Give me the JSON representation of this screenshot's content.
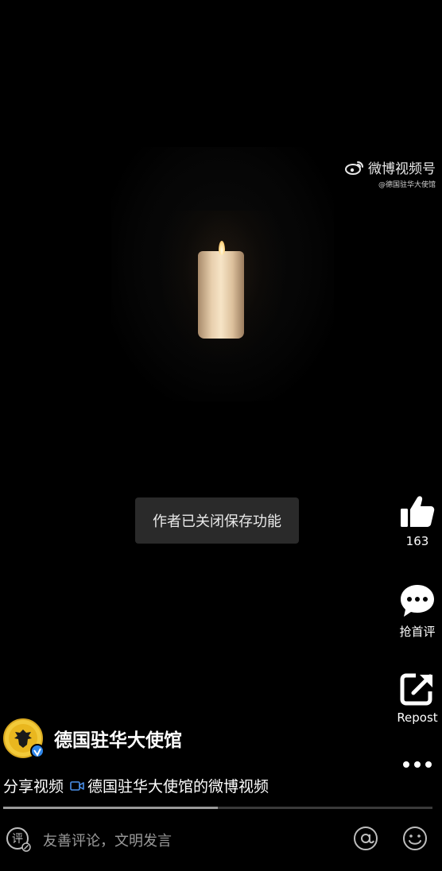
{
  "watermark": {
    "title": "微博视频号",
    "subtitle": "@德国驻华大使馆"
  },
  "toast": {
    "message": "作者已关闭保存功能"
  },
  "actions": {
    "like_count": "163",
    "comment_label": "抢首评",
    "repost_label": "Repost"
  },
  "author": {
    "name": "德国驻华大使馆"
  },
  "caption": {
    "prefix": "分享视频",
    "video_title": "德国驻华大使馆的微博视频"
  },
  "progress": {
    "fraction": 0.5
  },
  "comment_bar": {
    "placeholder": "友善评论，文明发言"
  },
  "icons": {
    "watermark": "weibo-logo-icon",
    "like": "thumbs-up-icon",
    "comment": "speech-bubble-icon",
    "repost": "share-arrow-icon",
    "more": "more-dots-icon",
    "video": "video-camera-icon",
    "edit": "comment-edit-icon",
    "mention": "at-sign-icon",
    "emoji": "emoji-icon"
  },
  "colors": {
    "background": "#000000",
    "verified": "#2f86e8",
    "avatar": "#f2ca3a",
    "toast": "#2a2a2a"
  }
}
